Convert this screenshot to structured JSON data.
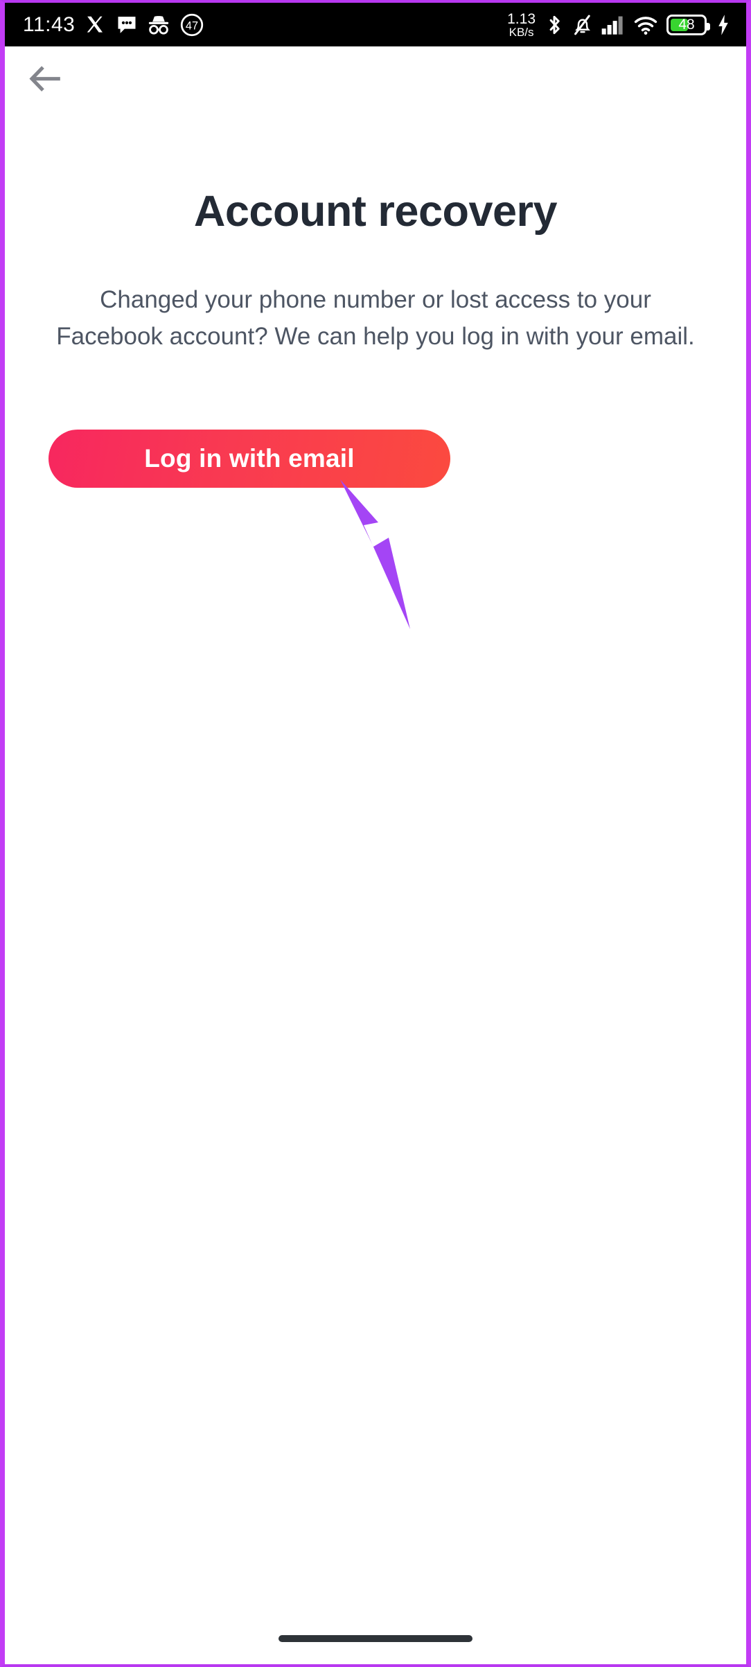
{
  "status_bar": {
    "time": "11:43",
    "network_speed_value": "1.13",
    "network_speed_unit": "KB/s",
    "dnd_badge": "47",
    "battery_percent": "48",
    "battery_color": "#38d430",
    "icons": {
      "x_app": "x-twitter-icon",
      "messages": "messages-icon",
      "incognito": "incognito-icon",
      "timer_badge": "timer-badge-icon",
      "bluetooth": "bluetooth-icon",
      "silent": "bell-muted-icon",
      "cellular": "signal-bars-icon",
      "wifi": "wifi-icon",
      "charging": "charging-bolt-icon"
    }
  },
  "appbar": {
    "back_label": "back-arrow"
  },
  "main": {
    "heading": "Account recovery",
    "description": "Changed your phone number or lost access to your Facebook account? We can help you log in with your email.",
    "cta_label": "Log in with email",
    "cta_gradient_start": "#f7275f",
    "cta_gradient_end": "#fb4a3f"
  },
  "annotation": {
    "arrow_color": "#a445f5",
    "points_at": "Log in with email"
  },
  "system": {
    "gesture_bar": "home-gesture-bar"
  }
}
